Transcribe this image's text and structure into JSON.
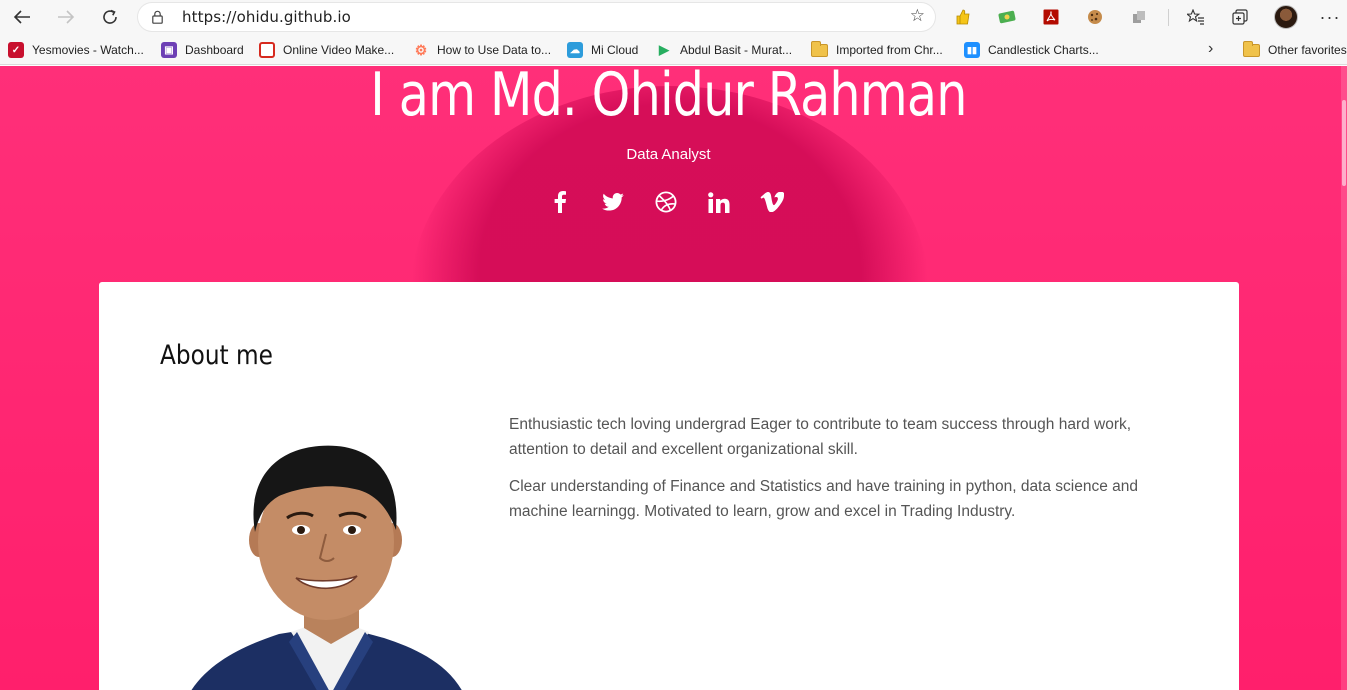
{
  "browser": {
    "url": "https://ohidu.github.io",
    "icons": {
      "back": "back-arrow-icon",
      "forward": "forward-arrow-icon",
      "refresh": "refresh-icon",
      "lock": "lock-icon",
      "favorite": "star-icon"
    },
    "bookmarks": [
      {
        "label": "Yesmovies - Watch...",
        "icon": "yesmovies-icon",
        "color": "#c8102e"
      },
      {
        "label": "Dashboard",
        "icon": "dashboard-icon",
        "color": "#6d3fb5"
      },
      {
        "label": "Online Video Make...",
        "icon": "video-maker-icon",
        "color": "#d62a1f"
      },
      {
        "label": "How to Use Data to...",
        "icon": "hubspot-icon",
        "color": "#ff7a59"
      },
      {
        "label": "Mi Cloud",
        "icon": "cloud-icon",
        "color": "#2d9cdb"
      },
      {
        "label": "Abdul Basit - Murat...",
        "icon": "play-icon",
        "color": "#27ae60"
      },
      {
        "label": "Imported from Chr...",
        "icon": "folder-icon",
        "color": "#f0c24a"
      },
      {
        "label": "Candlestick Charts...",
        "icon": "chart-icon",
        "color": "#1e90ff"
      }
    ],
    "other_favorites": "Other favorites"
  },
  "hero": {
    "title": "I am Md. Ohidur Rahman",
    "subtitle": "Data Analyst",
    "socials": [
      "facebook-icon",
      "twitter-icon",
      "dribbble-icon",
      "linkedin-icon",
      "vimeo-icon"
    ],
    "accent": "#ff2a75"
  },
  "about": {
    "heading": "About me",
    "paragraph1": "Enthusiastic tech loving undergrad Eager to contribute to team success through hard work, attention to detail and excellent organizational skill.",
    "paragraph2": "Clear understanding of Finance and Statistics and have training in python, data science and machine learningg. Motivated to learn, grow and excel in Trading Industry."
  }
}
